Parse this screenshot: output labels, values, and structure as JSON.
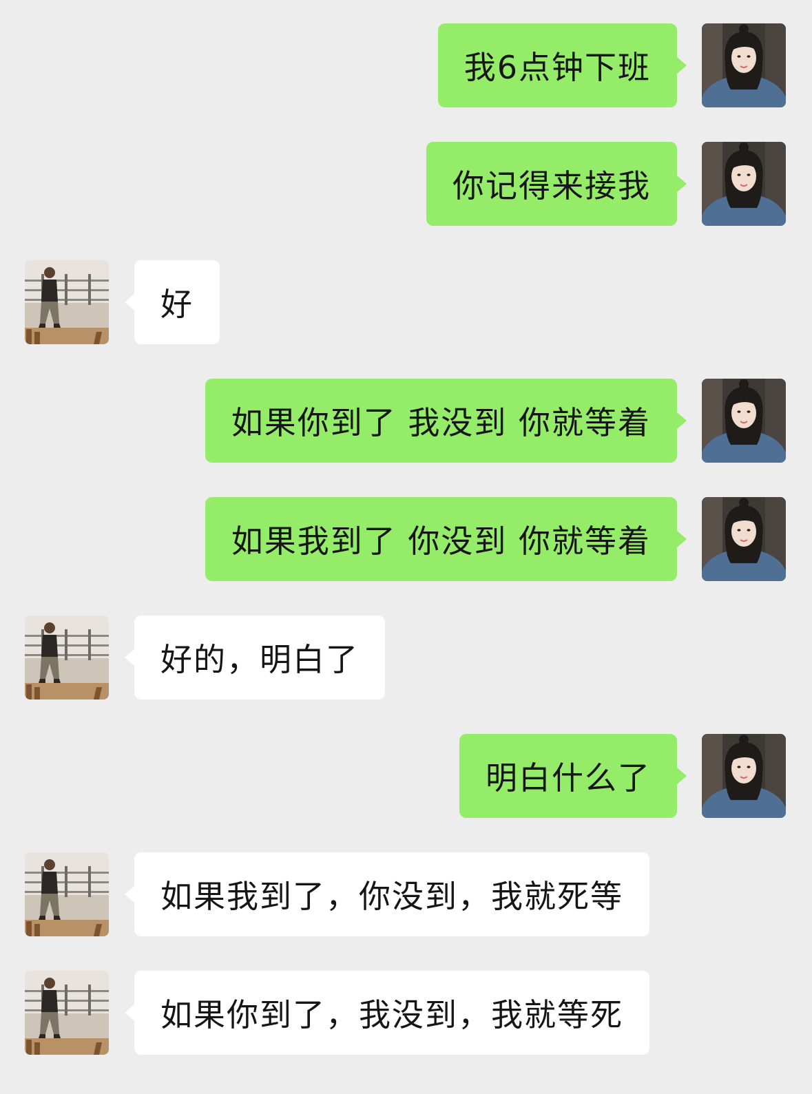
{
  "messages": [
    {
      "sender": "me",
      "text": "我6点钟下班"
    },
    {
      "sender": "me",
      "text": "你记得来接我"
    },
    {
      "sender": "other",
      "text": "好"
    },
    {
      "sender": "me",
      "text": "如果你到了 我没到 你就等着"
    },
    {
      "sender": "me",
      "text": "如果我到了 你没到 你就等着"
    },
    {
      "sender": "other",
      "text": "好的，明白了"
    },
    {
      "sender": "me",
      "text": "明白什么了"
    },
    {
      "sender": "other",
      "text": "如果我到了，你没到，我就死等"
    },
    {
      "sender": "other",
      "text": "如果你到了，我没到，我就等死"
    }
  ],
  "colors": {
    "background": "#ededed",
    "outgoing_bubble": "#95ec69",
    "incoming_bubble": "#ffffff",
    "text": "#151515"
  }
}
